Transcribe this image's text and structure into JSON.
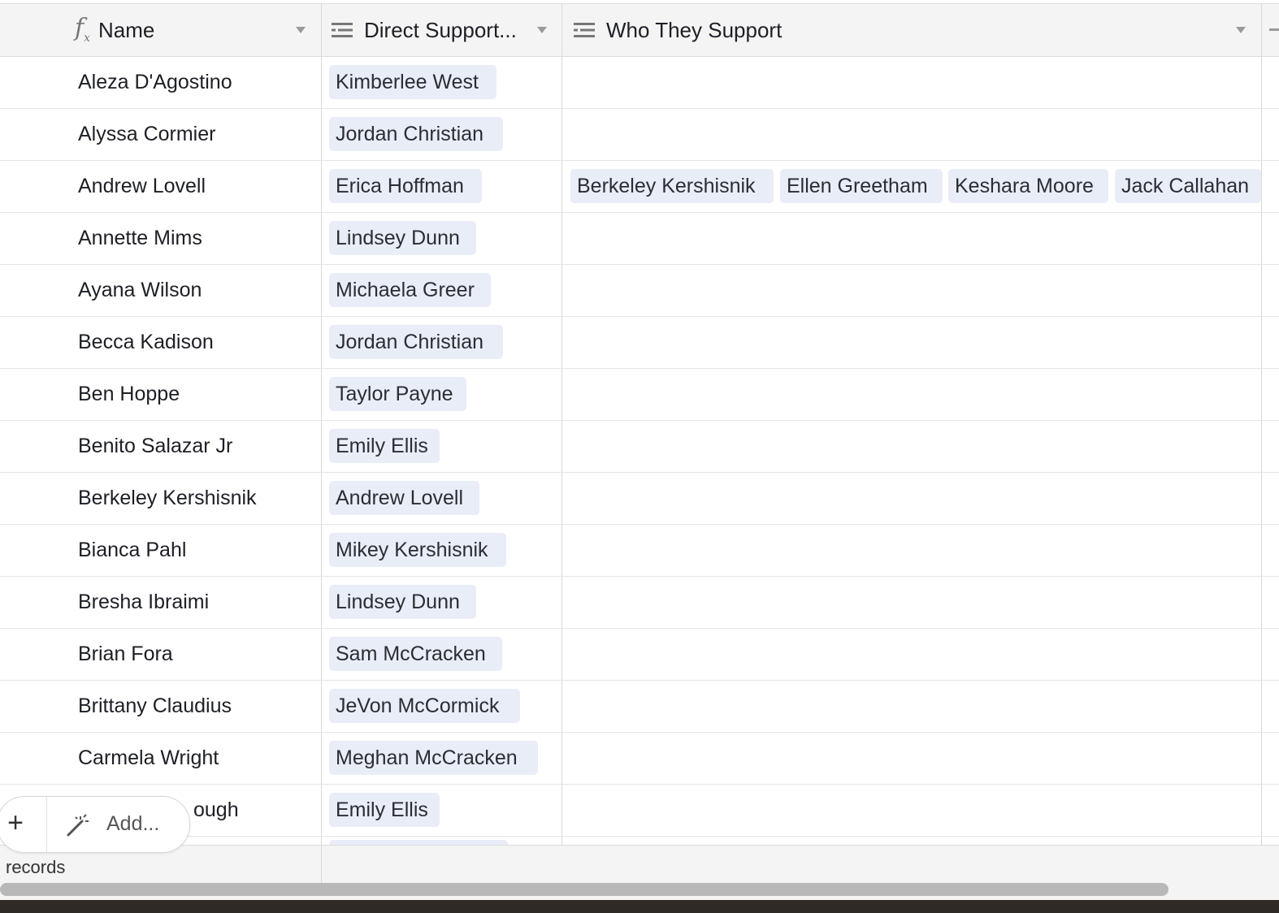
{
  "header": {
    "name_label": "Name",
    "direct_support_label": "Direct Support...",
    "who_they_support_label": "Who They Support"
  },
  "rows": [
    {
      "name": "Aleza D'Agostino",
      "direct_support": "Kimberlee West",
      "who_they_support": []
    },
    {
      "name": "Alyssa Cormier",
      "direct_support": "Jordan Christian",
      "who_they_support": []
    },
    {
      "name": "Andrew Lovell",
      "direct_support": "Erica Hoffman",
      "who_they_support": [
        "Berkeley Kershisnik",
        "Ellen Greetham",
        "Keshara Moore",
        "Jack Callahan"
      ]
    },
    {
      "name": "Annette Mims",
      "direct_support": "Lindsey Dunn",
      "who_they_support": []
    },
    {
      "name": "Ayana Wilson",
      "direct_support": "Michaela Greer",
      "who_they_support": []
    },
    {
      "name": "Becca Kadison",
      "direct_support": "Jordan Christian",
      "who_they_support": []
    },
    {
      "name": "Ben Hoppe",
      "direct_support": "Taylor Payne",
      "who_they_support": []
    },
    {
      "name": "Benito Salazar Jr",
      "direct_support": "Emily Ellis",
      "who_they_support": []
    },
    {
      "name": "Berkeley Kershisnik",
      "direct_support": "Andrew Lovell",
      "who_they_support": []
    },
    {
      "name": "Bianca Pahl",
      "direct_support": "Mikey Kershisnik",
      "who_they_support": []
    },
    {
      "name": "Bresha Ibraimi",
      "direct_support": "Lindsey Dunn",
      "who_they_support": []
    },
    {
      "name": "Brian Fora",
      "direct_support": "Sam McCracken",
      "who_they_support": []
    },
    {
      "name": "Brittany Claudius",
      "direct_support": "JeVon McCormick",
      "who_they_support": []
    },
    {
      "name": "Carmela Wright",
      "direct_support": "Meghan McCracken",
      "who_they_support": []
    },
    {
      "name": "ough",
      "direct_support": "Emily Ellis",
      "who_they_support": []
    }
  ],
  "footer": {
    "records_label": "records"
  },
  "add_button": {
    "plus": "+",
    "label": "Add..."
  },
  "colors": {
    "chip_bg": "#e9edf7",
    "header_bg": "#f4f4f4"
  }
}
